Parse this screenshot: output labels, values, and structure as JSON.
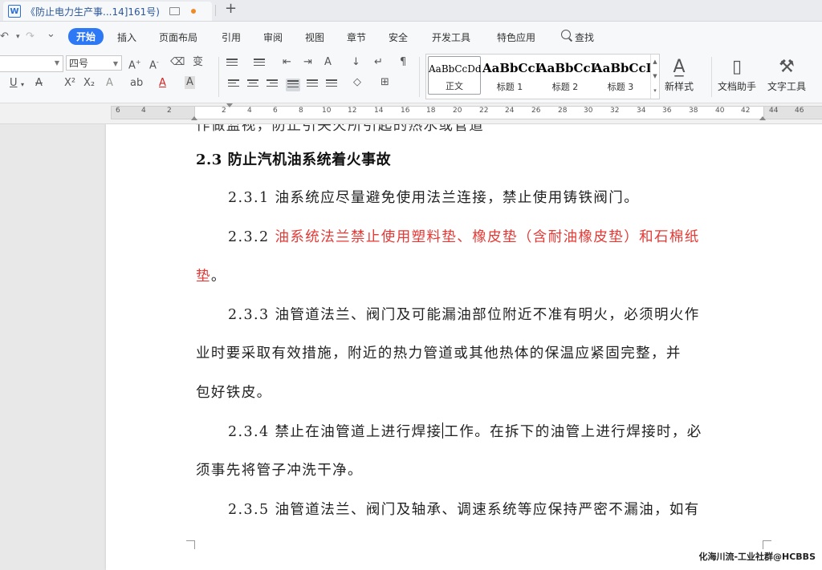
{
  "tab": {
    "logo": "W",
    "title": "《防止电力生产事...14]161号)",
    "add": "+"
  },
  "menu": {
    "undo": "↶",
    "redo": "↷",
    "more": "⌄",
    "items": [
      "开始",
      "插入",
      "页面布局",
      "引用",
      "审阅",
      "视图",
      "章节",
      "安全",
      "开发工具",
      "特色应用",
      "查找"
    ],
    "active_index": 0
  },
  "ribbon": {
    "font_name": "",
    "font_size": "四号",
    "styles": [
      {
        "sample": "AaBbCcDd",
        "name": "正文"
      },
      {
        "sample": "AaBbCcI",
        "name": "标题 1"
      },
      {
        "sample": "AaBbCcI",
        "name": "标题 2"
      },
      {
        "sample": "AaBbCcI",
        "name": "标题 3"
      }
    ],
    "new_style": "新样式",
    "doc_assistant": "文档助手",
    "text_tools": "文字工具"
  },
  "ruler": {
    "labels": [
      "6",
      "4",
      "2",
      "2",
      "4",
      "6",
      "8",
      "10",
      "12",
      "14",
      "16",
      "18",
      "20",
      "22",
      "24",
      "26",
      "28",
      "30",
      "32",
      "34",
      "36",
      "38",
      "40",
      "42",
      "44",
      "46"
    ]
  },
  "document": {
    "cut_line": "作做监视，防止引失火所引起的热水或管道",
    "heading": "2.3 防止汽机油系统着火事故",
    "p1": "2.3.1 油系统应尽量避免使用法兰连接，禁止使用铸铁阀门。",
    "p2_num": "2.3.2 ",
    "p2_red_a": "油系统法兰禁止使用塑料垫、橡皮垫（含耐油橡皮垫）和石棉纸",
    "p2_red_b": "垫",
    "p2_end": "。",
    "p3_a": "2.3.3 油管道法兰、阀门及可能漏油部位附近不准有明火，必须明火作",
    "p3_b": "业时要采取有效措施，附近的热力管道或其他热体的保温应紧固完整，并",
    "p3_c": "包好铁皮。",
    "p4_a1": "2.3.4 禁止在油管道上进行焊接",
    "p4_a2": "工作。在拆下的油管上进行焊接时，必",
    "p4_b": "须事先将管子冲洗干净。",
    "p5_a": "2.3.5 油管道法兰、阀门及轴承、调速系统等应保持严密不漏油，如有"
  },
  "watermark": "化海川流-工业社群@HCBBS"
}
